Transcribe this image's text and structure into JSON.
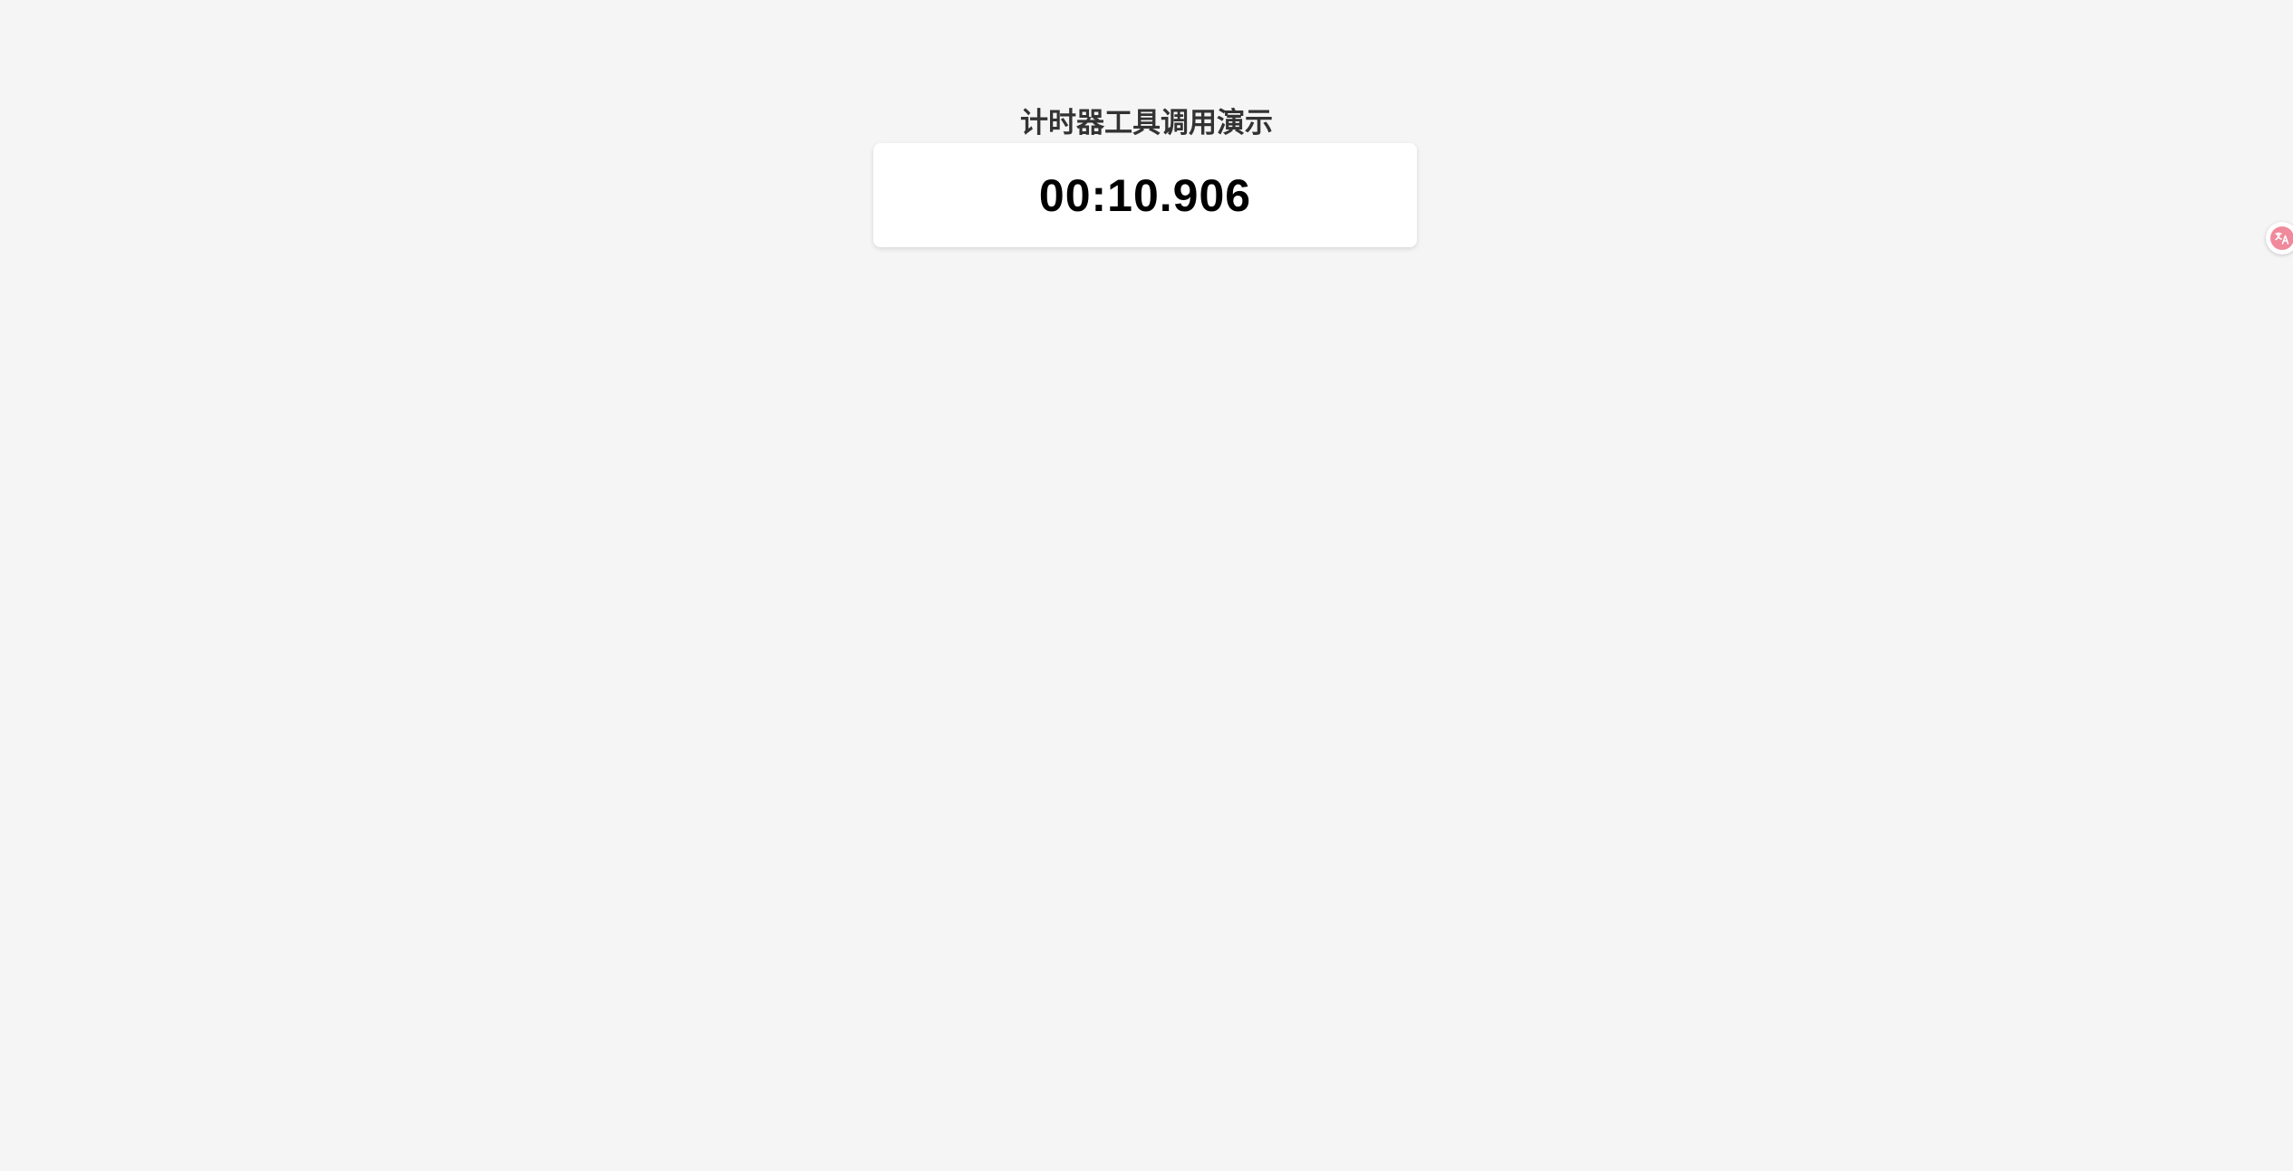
{
  "page": {
    "title": "计时器工具调用演示"
  },
  "timer": {
    "display": "00:10.906"
  },
  "translate_widget": {
    "icon": "translate-icon",
    "color": "#f0899b"
  }
}
